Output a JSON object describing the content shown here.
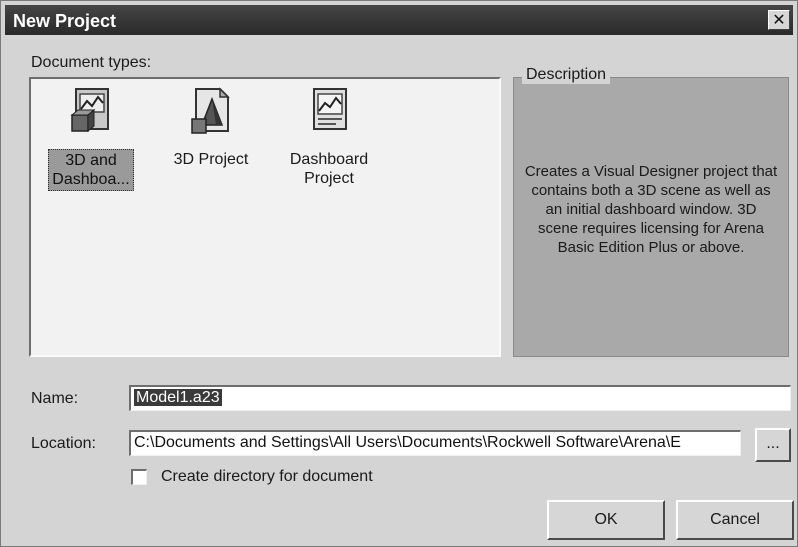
{
  "window": {
    "title": "New Project",
    "close_glyph": "✕"
  },
  "document_types": {
    "label": "Document types:",
    "items": [
      {
        "label_line1": "3D and",
        "label_line2": "Dashboa...",
        "icon": "3d-dashboard-icon",
        "selected": true
      },
      {
        "label_line1": "3D Project",
        "label_line2": "",
        "icon": "3d-project-icon",
        "selected": false
      },
      {
        "label_line1": "Dashboard",
        "label_line2": "Project",
        "icon": "dashboard-project-icon",
        "selected": false
      }
    ]
  },
  "description": {
    "legend": "Description",
    "text": "Creates a Visual Designer project that contains both a 3D scene as well as an initial dashboard window. 3D scene requires licensing for Arena Basic Edition Plus or above."
  },
  "name_field": {
    "label": "Name:",
    "value": "Model1.a23"
  },
  "location_field": {
    "label": "Location:",
    "value": "C:\\Documents and Settings\\All Users\\Documents\\Rockwell Software\\Arena\\E",
    "browse_label": "..."
  },
  "create_directory": {
    "label": "Create directory for document",
    "checked": false
  },
  "buttons": {
    "ok": "OK",
    "cancel": "Cancel"
  }
}
